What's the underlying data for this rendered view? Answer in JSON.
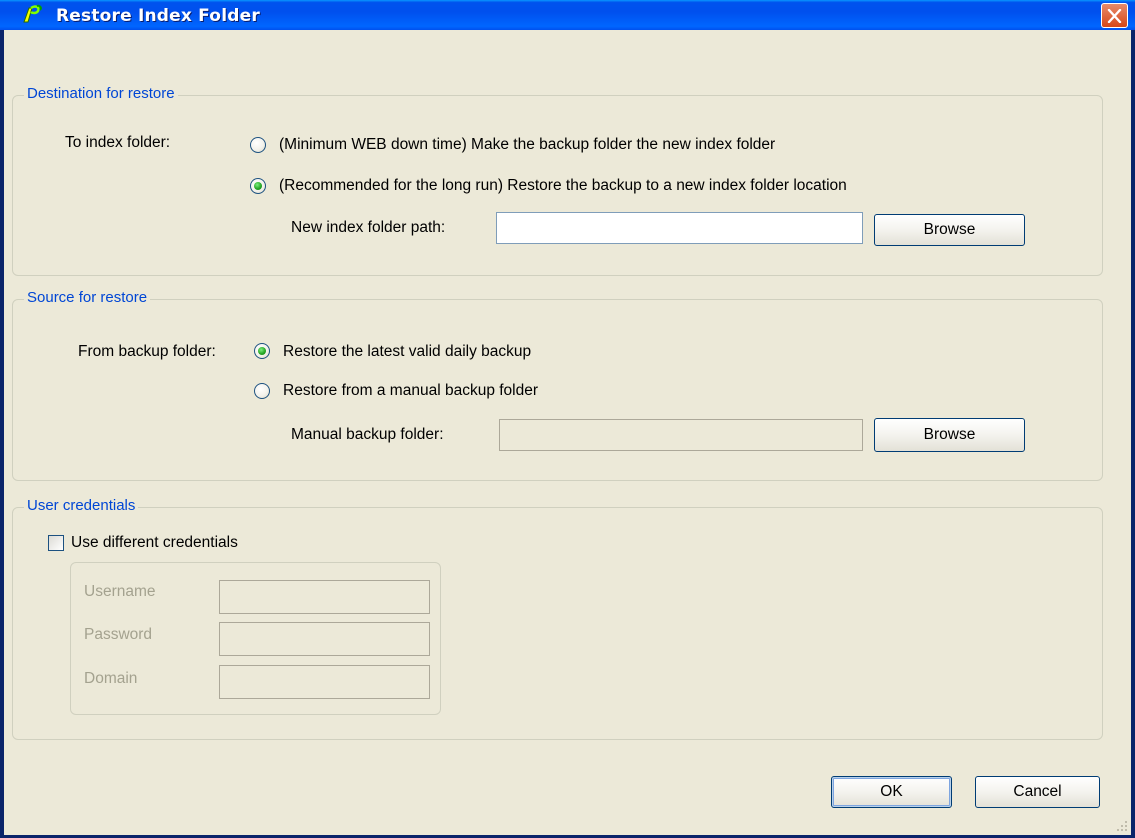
{
  "window": {
    "title": "Restore Index Folder",
    "colors": {
      "titlebar": "#0054e3",
      "dialog_bg": "#ece9d8",
      "group_title": "#0046d5",
      "close_button": "#d64818",
      "radio_dot": "#21a121"
    }
  },
  "destination": {
    "legend": "Destination for restore",
    "to_index_label": "To index folder:",
    "option_min_downtime": "(Minimum WEB down time) Make the backup folder the new index folder",
    "option_recommended": "(Recommended for the long run) Restore the backup to a new index folder location",
    "selected_option": "option_recommended",
    "new_path_label": "New index folder path:",
    "new_path_value": "",
    "browse_label": "Browse"
  },
  "source": {
    "legend": "Source for restore",
    "from_backup_label": "From backup folder:",
    "option_latest": "Restore the latest valid daily backup",
    "option_manual": "Restore from a manual backup folder",
    "selected_option": "option_latest",
    "manual_folder_label": "Manual backup folder:",
    "manual_folder_value": "",
    "browse_label": "Browse"
  },
  "credentials": {
    "legend": "User credentials",
    "use_different_label": "Use different credentials",
    "use_different_checked": false,
    "username_label": "Username",
    "password_label": "Password",
    "domain_label": "Domain"
  },
  "footer": {
    "ok_label": "OK",
    "cancel_label": "Cancel"
  }
}
